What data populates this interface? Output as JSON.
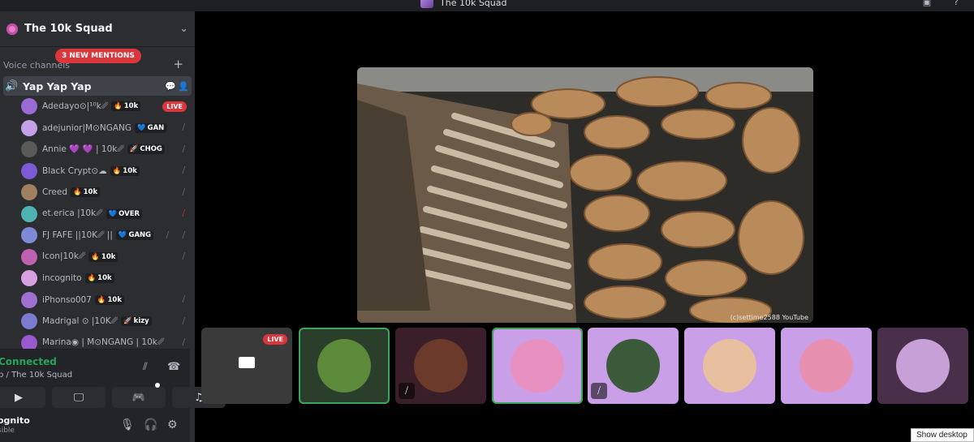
{
  "window": {
    "title": "The 10k Squad"
  },
  "server": {
    "name": "The 10k Squad"
  },
  "category": {
    "label": "Voice channels",
    "mentions": "3 NEW MENTIONS"
  },
  "channel": {
    "name": "Yap Yap Yap"
  },
  "users": [
    {
      "name": "Adedayo⊙|¹⁰k␥",
      "tag": "10k",
      "tag_icon": "🔥",
      "badge": "LIVE",
      "status": "live",
      "color": "#9a6bd4"
    },
    {
      "name": "adejunior|M⊙NGANG",
      "tag": "GAN",
      "tag_icon": "💙",
      "status": "muted",
      "color": "#c4a0e8"
    },
    {
      "name": "Annie 💜 💜 | 10k␥",
      "tag": "CHOG",
      "tag_icon": "🚀",
      "status": "muted",
      "color": "#5a5a5a"
    },
    {
      "name": "Black Crypt⊙☁",
      "tag": "10k",
      "tag_icon": "🔥",
      "status": "muted",
      "color": "#7b5cd6"
    },
    {
      "name": "Creed",
      "tag": "10k",
      "tag_icon": "🔥",
      "status": "muted",
      "color": "#a08060"
    },
    {
      "name": "et.erica |10k␥",
      "tag": "OVER",
      "tag_icon": "💙",
      "status": "server-muted",
      "color": "#4fb3b3"
    },
    {
      "name": "FJ FAFE ||10K␥ ||",
      "tag": "GANG",
      "tag_icon": "💙",
      "status": "muted-deafened",
      "color": "#7e8ad6"
    },
    {
      "name": "Icon|10k␥",
      "tag": "10k",
      "tag_icon": "🔥",
      "status": "muted",
      "color": "#c060b0"
    },
    {
      "name": "incognito",
      "tag": "10k",
      "tag_icon": "🔥",
      "status": "none",
      "color": "#d8a0e0"
    },
    {
      "name": "iPhonso007",
      "tag": "10k",
      "tag_icon": "🔥",
      "status": "muted",
      "color": "#a070d0"
    },
    {
      "name": "Madrigal ⊙ |10K␥",
      "tag": "kizy",
      "tag_icon": "🚀",
      "status": "muted",
      "color": "#7b7bd0"
    },
    {
      "name": "Marina◉ | M⊙NGANG | 10k␥",
      "tag": "",
      "tag_icon": "",
      "status": "muted",
      "color": "#9b59d0"
    }
  ],
  "voice_status": {
    "connected": "Connected",
    "location": "p / The 10k Squad"
  },
  "user_panel": {
    "name": "ognito",
    "status": "sible"
  },
  "stage": {
    "watermark": "(c)settime2588 YouTube"
  },
  "tiles": [
    {
      "kind": "stream",
      "badge": "LIVE",
      "bg": "#3a3a3a"
    },
    {
      "kind": "avatar",
      "bg": "#2b3d2b",
      "av": "#5a8a3a",
      "border": "#3ba55c"
    },
    {
      "kind": "avatar",
      "bg": "#3a1f2a",
      "av": "#6b3a2a",
      "muted": true
    },
    {
      "kind": "avatar",
      "bg": "#c9a0e8",
      "av": "#e890c0",
      "border": "#3ba55c"
    },
    {
      "kind": "avatar",
      "bg": "#c9a0e8",
      "av": "#3a5a3a",
      "muted": true
    },
    {
      "kind": "avatar",
      "bg": "#c9a0e8",
      "av": "#e8c0a0"
    },
    {
      "kind": "avatar",
      "bg": "#c9a0e8",
      "av": "#e890b0"
    },
    {
      "kind": "avatar",
      "bg": "#4a2f4a",
      "av": "#c8a0d8"
    }
  ],
  "taskbar": {
    "show_desktop": "Show desktop"
  }
}
